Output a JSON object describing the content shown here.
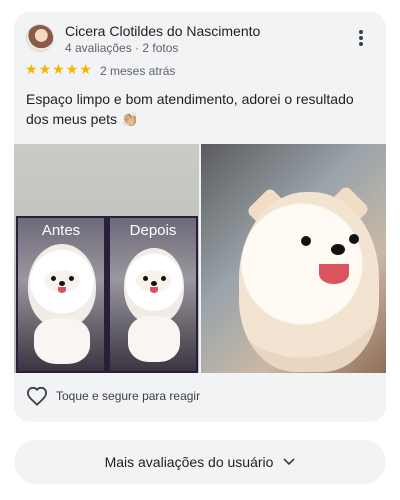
{
  "review": {
    "author_name": "Cicera Clotildes do Nascimento",
    "author_meta": "4 avaliações · 2 fotos",
    "rating": 5,
    "stars": [
      "★",
      "★",
      "★",
      "★",
      "★"
    ],
    "time": "2 meses atrás",
    "text": "Espaço limpo e bom atendimento, adorei o resultado dos meus pets 👏🏼",
    "photos": {
      "before_label": "Antes",
      "after_label": "Depois"
    },
    "reaction_label": "Toque e segure para reagir"
  },
  "footer": {
    "more_reviews_label": "Mais avaliações do usuário"
  },
  "colors": {
    "card_bg": "#f2f3f5",
    "star": "#f4b400",
    "secondary_text": "#5f6368"
  },
  "icons": {
    "more": "more-vert-icon",
    "heart": "heart-outline-icon",
    "chevron": "chevron-down-icon"
  }
}
